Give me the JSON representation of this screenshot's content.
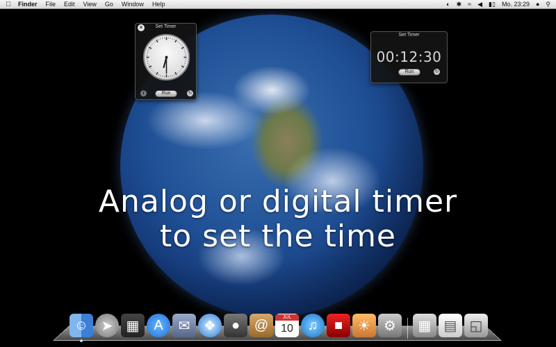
{
  "menubar": {
    "apple_icon": "apple-logo",
    "app_name": "Finder",
    "menus": [
      "File",
      "Edit",
      "View",
      "Go",
      "Window",
      "Help"
    ],
    "status": {
      "clock_text": "Mo. 23:29",
      "icons": [
        "time-machine-icon",
        "bluetooth-icon",
        "wifi-icon",
        "volume-icon",
        "battery-icon",
        "user-icon",
        "spotlight-icon"
      ]
    }
  },
  "caption": {
    "line1": "Analog or digital timer",
    "line2": "to set the time"
  },
  "analog_widget": {
    "title": "Set Timer",
    "run_label": "Run",
    "info_glyph": "i",
    "clock_hands": {
      "hour": 6,
      "minute": 30
    }
  },
  "digital_widget": {
    "title": "Set Timer",
    "time": "00:12:30",
    "run_label": "Run"
  },
  "dock": {
    "items": [
      "finder-icon",
      "launchpad-icon",
      "mission-control-icon",
      "app-store-icon",
      "mail-stamp-icon",
      "safari-icon",
      "facetime-icon",
      "address-book-icon",
      "calendar-icon",
      "itunes-icon",
      "photo-booth-icon",
      "iphoto-icon",
      "system-preferences-icon",
      "downloads-stack-icon",
      "documents-stack-icon",
      "trash-icon"
    ],
    "calendar": {
      "month": "JUL",
      "day": "10"
    }
  }
}
